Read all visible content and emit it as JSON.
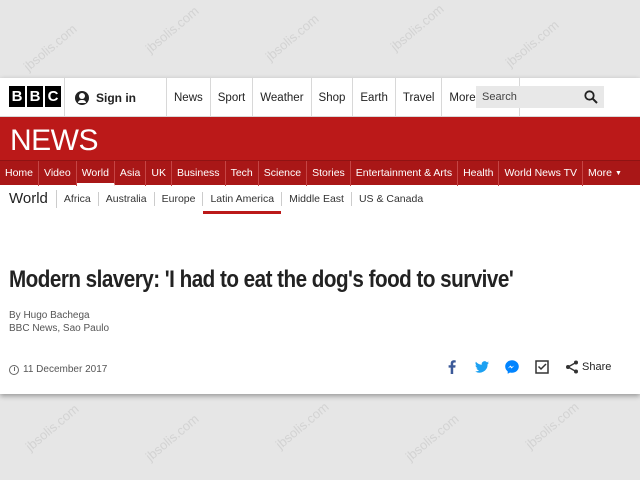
{
  "logo": [
    "B",
    "B",
    "C"
  ],
  "signin_label": "Sign in",
  "top_nav": [
    "News",
    "Sport",
    "Weather",
    "Shop",
    "Earth",
    "Travel"
  ],
  "top_more_label": "More",
  "search_placeholder": "Search",
  "news_title": "NEWS",
  "section_nav": [
    "Home",
    "Video",
    "World",
    "Asia",
    "UK",
    "Business",
    "Tech",
    "Science",
    "Stories",
    "Entertainment & Arts",
    "Health",
    "World News TV"
  ],
  "section_active": "World",
  "section_more_label": "More",
  "world_title": "World",
  "world_nav": [
    "Africa",
    "Australia",
    "Europe",
    "Latin America",
    "Middle East",
    "US & Canada"
  ],
  "world_active": "Latin America",
  "headline": "Modern slavery: 'I had to eat the dog's food to survive'",
  "byline_name": "By Hugo Bachega",
  "byline_role": "BBC News, Sao Paulo",
  "date": "11 December 2017",
  "share_label": "Share",
  "watermark": "jbsolis.com",
  "colors": {
    "brand_red": "#bb1919",
    "nav_red": "#a91717",
    "twitter": "#1da1f2",
    "facebook": "#3b5998"
  }
}
